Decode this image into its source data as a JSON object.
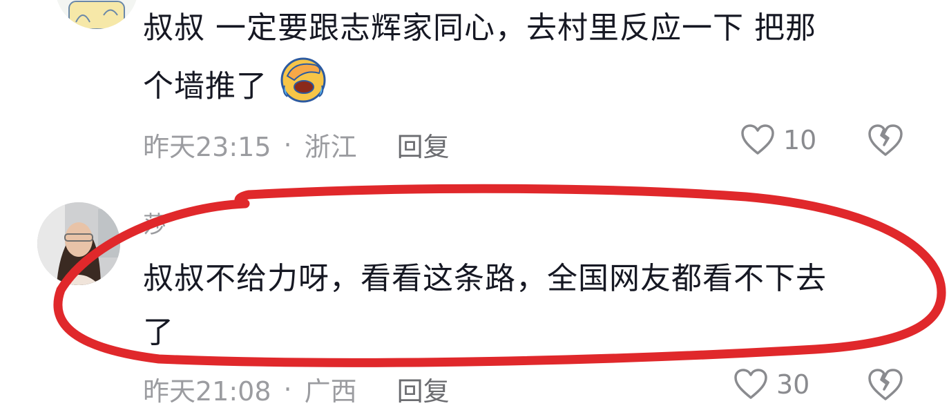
{
  "comments": [
    {
      "text_line1": "叔叔 一定要跟志辉家同心，去村里反应一下  把那",
      "text_line2": "个墙推了",
      "emoji": "facepalm-crying-emoji",
      "time": "昨天23:15",
      "location": "浙江",
      "reply_label": "回复",
      "like_count": "10"
    },
    {
      "username": "莎",
      "text_line1": "叔叔不给力呀，看看这条路，全国网友都看不下去",
      "text_line2": "了",
      "time": "昨天21:08",
      "location": "广西",
      "reply_label": "回复",
      "like_count": "30"
    }
  ],
  "icons": {
    "like": "heart-icon",
    "dislike": "broken-heart-icon"
  },
  "colors": {
    "text": "#161823",
    "meta": "#9b9ca0",
    "highlight": "#e0282b"
  }
}
